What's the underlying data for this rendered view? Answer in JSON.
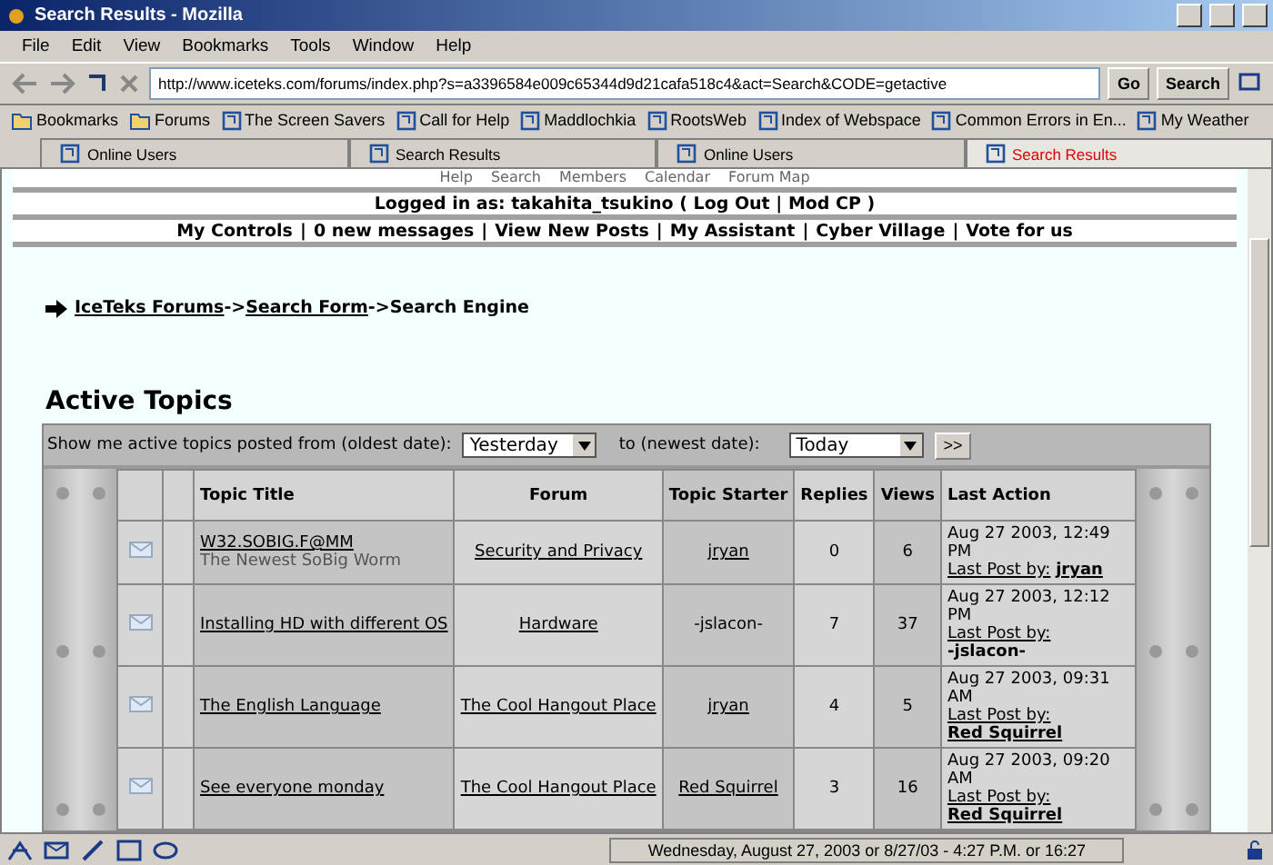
{
  "window": {
    "title": "Search Results - Mozilla"
  },
  "menu": [
    "File",
    "Edit",
    "View",
    "Bookmarks",
    "Tools",
    "Window",
    "Help"
  ],
  "navbar": {
    "url": "http://www.iceteks.com/forums/index.php?s=a3396584e009c65344d9d21cafa518c4&act=Search&CODE=getactive",
    "go": "Go",
    "search": "Search"
  },
  "bookmarks": [
    {
      "label": "Bookmarks",
      "kind": "folder"
    },
    {
      "label": "Forums",
      "kind": "folder"
    },
    {
      "label": "The Screen Savers",
      "kind": "link"
    },
    {
      "label": "Call for Help",
      "kind": "link"
    },
    {
      "label": "Maddlochkia",
      "kind": "link"
    },
    {
      "label": "RootsWeb",
      "kind": "link"
    },
    {
      "label": "Index of Webspace",
      "kind": "link"
    },
    {
      "label": "Common Errors in En...",
      "kind": "link"
    },
    {
      "label": "My Weather",
      "kind": "link"
    }
  ],
  "tabs": [
    {
      "label": "Online Users",
      "selected": false
    },
    {
      "label": "Search Results",
      "selected": false
    },
    {
      "label": "Online Users",
      "selected": false
    },
    {
      "label": "Search Results",
      "selected": true
    }
  ],
  "forum_nav": [
    "Help",
    "Search",
    "Members",
    "Calendar",
    "Forum Map"
  ],
  "logged_in": {
    "label": "Logged in as: takahita_tsukino ( ",
    "log_out": "Log Out",
    "sep": " | ",
    "mod_cp": "Mod CP",
    " end": " )"
  },
  "user_links": {
    "separator": "|",
    "items": [
      "My Controls",
      "0 new messages",
      "View New Posts",
      "My Assistant",
      "Cyber Village",
      "Vote for us"
    ]
  },
  "breadcrumb": {
    "links": [
      "IceTeks Forums",
      "Search Form"
    ],
    "current": "Search Engine",
    "sep": "->"
  },
  "heading": "Active Topics",
  "filter": {
    "from_label": "Show me active topics posted from (oldest date):",
    "from": "Yesterday",
    "to_label": "to (newest date):",
    "to": "Today",
    "go": ">>"
  },
  "table": {
    "columns": [
      "Topic Title",
      "Forum",
      "Topic Starter",
      "Replies",
      "Views",
      "Last Action"
    ],
    "rows": [
      {
        "title": "W32.SOBIG.F@MM",
        "description": "The Newest SoBig Worm",
        "forum": "Security and Privacy",
        "starter": "jryan",
        "starter_link": true,
        "replies": "0",
        "views": "6",
        "date": "Aug 27 2003, 12:49 PM",
        "last_label": "Last Post by:",
        "last_by": "jryan",
        "last_link": true
      },
      {
        "title": "Installing HD with different OS",
        "forum": "Hardware",
        "starter": "-jslacon-",
        "starter_link": false,
        "replies": "7",
        "views": "37",
        "date": "Aug 27 2003, 12:12 PM",
        "last_label": "Last Post by:",
        "last_by": "-jslacon-",
        "last_link": false
      },
      {
        "title": "The English Language",
        "forum": "The Cool Hangout Place",
        "starter": "jryan",
        "starter_link": true,
        "replies": "4",
        "views": "5",
        "date": "Aug 27 2003, 09:31 AM",
        "last_label": "Last Post by:",
        "last_by": "Red Squirrel",
        "last_link": true
      },
      {
        "title": "See everyone monday",
        "forum": "The Cool Hangout Place",
        "starter": "Red Squirrel",
        "starter_link": true,
        "replies": "3",
        "views": "16",
        "date": "Aug 27 2003, 09:20 AM",
        "last_label": "Last Post by:",
        "last_by": "Red Squirrel",
        "last_link": true
      }
    ]
  },
  "status_bar": {
    "clock": "Wednesday, August 27, 2003 or 8/27/03 - 4:27 P.M. or 16:27"
  }
}
